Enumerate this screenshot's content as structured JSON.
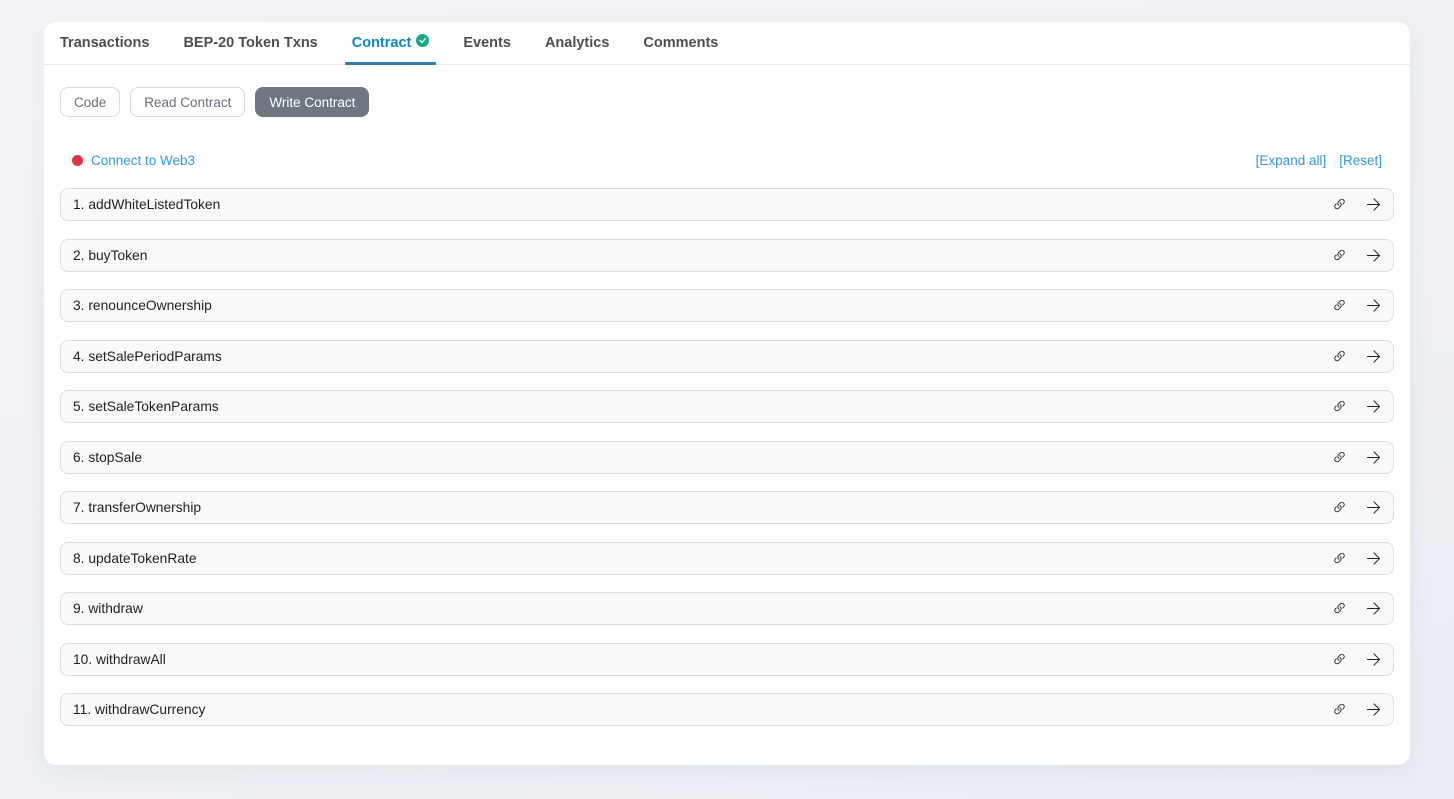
{
  "tabs": [
    {
      "label": "Transactions"
    },
    {
      "label": "BEP-20 Token Txns"
    },
    {
      "label": "Contract",
      "badge": "verified-check"
    },
    {
      "label": "Events"
    },
    {
      "label": "Analytics"
    },
    {
      "label": "Comments"
    }
  ],
  "active_tab": "Contract",
  "contract_subnav": [
    {
      "label": "Code"
    },
    {
      "label": "Read Contract"
    },
    {
      "label": "Write Contract"
    }
  ],
  "active_subnav": "Write Contract",
  "write_contract": {
    "connect_status": "disconnected",
    "connect_label": "Connect to Web3",
    "expand_all": "[Expand all]",
    "reset": "[Reset]",
    "functions": [
      {
        "label": "1. addWhiteListedToken"
      },
      {
        "label": "2. buyToken"
      },
      {
        "label": "3. renounceOwnership"
      },
      {
        "label": "4. setSalePeriodParams"
      },
      {
        "label": "5. setSaleTokenParams"
      },
      {
        "label": "6. stopSale"
      },
      {
        "label": "7. transferOwnership"
      },
      {
        "label": "8. updateTokenRate"
      },
      {
        "label": "9. withdraw"
      },
      {
        "label": "10. withdrawAll"
      },
      {
        "label": "11. withdrawCurrency"
      }
    ]
  },
  "colors": {
    "active_tab_text": "#0d86c9",
    "tab_underline": "#2b81b2",
    "link_blue": "#3498db",
    "verified_badge_green": "#1aa886",
    "disconnected_dot_red": "#dc3545",
    "active_button_bg": "#6e7680",
    "row_background": "#f8f9fa"
  }
}
